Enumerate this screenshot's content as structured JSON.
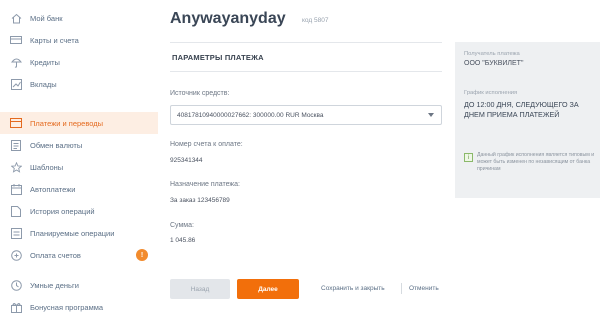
{
  "sidebar": {
    "items": [
      {
        "label": "Мой банк",
        "icon": "home-icon",
        "active": false
      },
      {
        "label": "Карты и счета",
        "icon": "card-icon",
        "active": false
      },
      {
        "label": "Кредиты",
        "icon": "umbrella-icon",
        "active": false
      },
      {
        "label": "Вклады",
        "icon": "chart-icon",
        "active": false
      },
      {
        "label": "Платежи и переводы",
        "icon": "transfer-icon",
        "active": true
      },
      {
        "label": "Обмен валюты",
        "icon": "exchange-icon",
        "active": false
      },
      {
        "label": "Шаблоны",
        "icon": "star-icon",
        "active": false
      },
      {
        "label": "Автоплатежи",
        "icon": "calendar-icon",
        "active": false
      },
      {
        "label": "История операций",
        "icon": "document-icon",
        "active": false
      },
      {
        "label": "Планируемые операции",
        "icon": "planned-icon",
        "active": false
      },
      {
        "label": "Оплата счетов",
        "icon": "invoice-icon",
        "active": false,
        "badge": "!"
      },
      {
        "label": "Умные деньги",
        "icon": "clock-icon",
        "active": false
      },
      {
        "label": "Бонусная программа",
        "icon": "gift-icon",
        "active": false
      }
    ]
  },
  "main": {
    "title": "Anywayanyday",
    "code": "код 5807",
    "section_title": "ПАРАМЕТРЫ ПЛАТЕЖА",
    "source": {
      "label": "Источник средств:",
      "value": "40817810940000027662: 300000.00 RUR Москва"
    },
    "account": {
      "label": "Номер счета к оплате:",
      "value": "925341344"
    },
    "purpose": {
      "label": "Назначение платежа:",
      "value": "За заказ 123456789"
    },
    "amount": {
      "label": "Сумма:",
      "value": "1 045.86"
    },
    "buttons": {
      "back": "Назад",
      "next": "Далее",
      "save": "Сохранить и закрыть",
      "cancel": "Отменить"
    }
  },
  "panel": {
    "recipient_label": "Получатель платежа",
    "recipient_value": "ООО \"БУКВИЛЕТ\"",
    "schedule_label": "График исполнения",
    "schedule_value": "ДО 12:00 ДНЯ, СЛЕДУЮЩЕГО ЗА ДНЕМ ПРИЕМА ПЛАТЕЖЕЙ",
    "note": "Данный график исполнения является типовым и может быть изменен по независящим от банка причинам"
  },
  "colors": {
    "accent": "#f26f0b",
    "link": "#5b6f86",
    "active_bg": "#fdeee3",
    "panel_bg": "#eef0f2"
  }
}
